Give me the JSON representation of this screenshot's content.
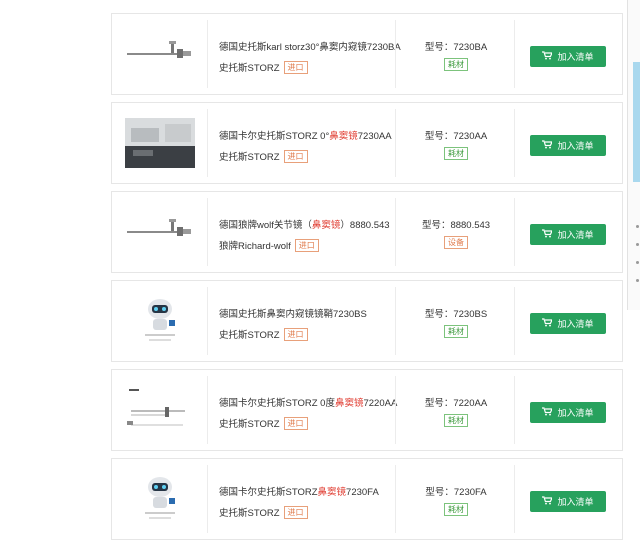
{
  "products": [
    {
      "name_parts": [
        "德国史托斯karl storz30°鼻窦内窥镜7230BA",
        "",
        ""
      ],
      "brand": "史托斯STORZ",
      "origin": "进口",
      "model": "型号：7230BA",
      "kind": "耗材",
      "kind_color": "green",
      "image": "endoscope-rod",
      "button": "加入清单"
    },
    {
      "name_parts": [
        "德国卡尔史托斯STORZ 0°",
        "鼻窦镜",
        "7230AA"
      ],
      "brand": "史托斯STORZ",
      "origin": "进口",
      "model": "型号：7230AA",
      "kind": "耗材",
      "kind_color": "green",
      "image": "equipment-photo",
      "button": "加入清单"
    },
    {
      "name_parts": [
        "德国狼牌wolf关节镜（",
        "鼻窦镜",
        "）8880.543"
      ],
      "brand": "狼牌Richard-wolf",
      "origin": "进口",
      "model": "型号：8880.543",
      "kind": "设备",
      "kind_color": "orange",
      "image": "endoscope-rod",
      "button": "加入清单"
    },
    {
      "name_parts": [
        "德国史托斯鼻窦内窥镜镜鞘7230BS",
        "",
        ""
      ],
      "brand": "史托斯STORZ",
      "origin": "进口",
      "model": "型号：7230BS",
      "kind": "耗材",
      "kind_color": "green",
      "image": "robot-placeholder",
      "button": "加入清单"
    },
    {
      "name_parts": [
        "德国卡尔史托斯STORZ 0度",
        "鼻窦镜",
        "7220AA"
      ],
      "brand": "史托斯STORZ",
      "origin": "进口",
      "model": "型号：7220AA",
      "kind": "耗材",
      "kind_color": "green",
      "image": "diagram-sheet",
      "button": "加入清单"
    },
    {
      "name_parts": [
        "德国卡尔史托斯STORZ",
        "鼻窦镜",
        "7230FA"
      ],
      "brand": "史托斯STORZ",
      "origin": "进口",
      "model": "型号：7230FA",
      "kind": "耗材",
      "kind_color": "green",
      "image": "robot-placeholder",
      "button": "加入清单"
    }
  ],
  "colors": {
    "button": "#27a15d",
    "highlight": "#e03c31",
    "tag_orange": "#e07b4c",
    "tag_green": "#3d9a3d"
  }
}
